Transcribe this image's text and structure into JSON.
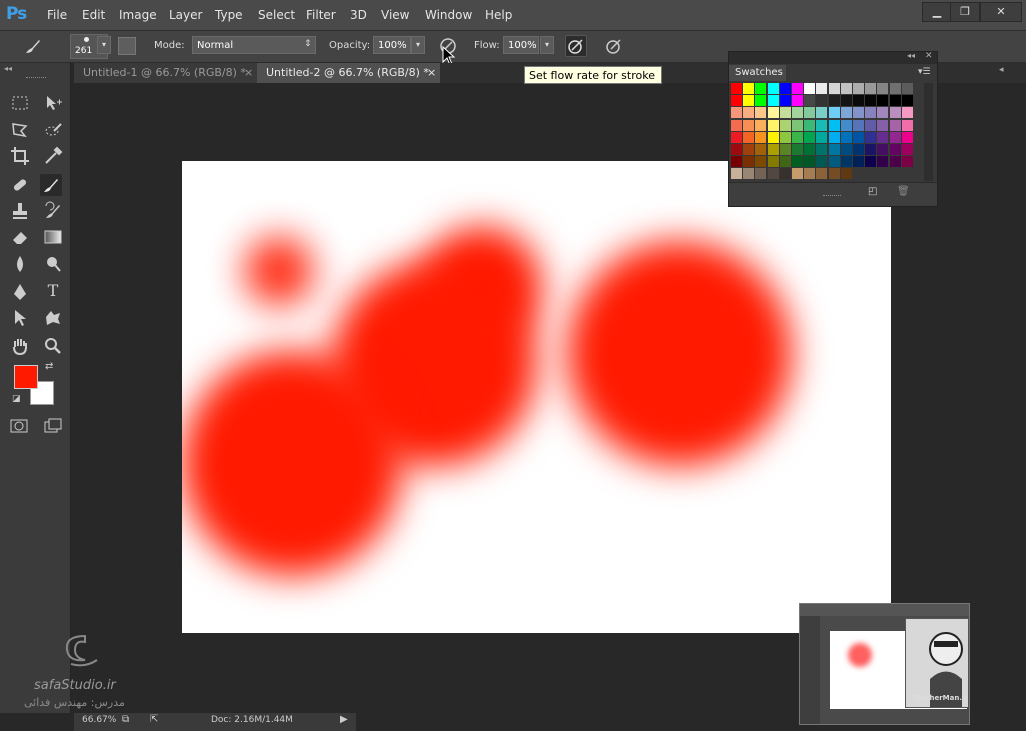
{
  "app": {
    "logo": "Ps"
  },
  "menu": [
    "File",
    "Edit",
    "Image",
    "Layer",
    "Type",
    "Select",
    "Filter",
    "3D",
    "View",
    "Window",
    "Help"
  ],
  "window_controls": {
    "minimize": "▁",
    "restore": "❐",
    "close": "✕"
  },
  "options": {
    "brush_size": "261",
    "mode_label": "Mode:",
    "mode_value": "Normal",
    "opacity_label": "Opacity:",
    "opacity_value": "100%",
    "flow_label": "Flow:",
    "flow_value": "100%"
  },
  "tooltip": "Set flow rate for stroke",
  "tabs": [
    {
      "label": "Untitled-1 @ 66.7% (RGB/8) *",
      "close": "×"
    },
    {
      "label": "Untitled-2 @ 66.7% (RGB/8) *",
      "close": "×"
    }
  ],
  "swatches_panel": {
    "title": "Swatches",
    "rows": [
      [
        "#ff0000",
        "#ffff00",
        "#00ff00",
        "#00ffff",
        "#0000ff",
        "#ff00ff",
        "#ffffff",
        "#ebebeb",
        "#d6d6d6",
        "#c2c2c2",
        "#adadad",
        "#999999",
        "#858585",
        "#707070",
        "#5c5c5c"
      ],
      [
        "#ff0000",
        "#ffff00",
        "#00ff00",
        "#00ffff",
        "#0000ff",
        "#ff00ff",
        "#474747",
        "#333333",
        "#1f1f1f",
        "#141414",
        "#0a0a0a",
        "#050505",
        "#000000",
        "#000000",
        "#000000"
      ],
      [
        "#f7977a",
        "#f9ad81",
        "#fdc68a",
        "#fff79a",
        "#c4df9b",
        "#a3d39c",
        "#82ca9d",
        "#7bcdc8",
        "#6ecff6",
        "#7ea7d8",
        "#8493ca",
        "#8882be",
        "#a187be",
        "#bc8dbf",
        "#f49ac2"
      ],
      [
        "#f26c4f",
        "#f68e55",
        "#fbaf5c",
        "#fff467",
        "#acd372",
        "#7cc576",
        "#3bb878",
        "#1abbb4",
        "#00bff3",
        "#438ccb",
        "#5574b9",
        "#605ca8",
        "#855fa8",
        "#a763a8",
        "#f06ea9"
      ],
      [
        "#ed1c24",
        "#f26522",
        "#f7941d",
        "#fff200",
        "#8dc73f",
        "#39b54a",
        "#00a651",
        "#00a99d",
        "#00aeef",
        "#0072bc",
        "#0054a6",
        "#2e3192",
        "#662d91",
        "#92278f",
        "#ec008c"
      ],
      [
        "#9e0b0f",
        "#a0410d",
        "#a36209",
        "#aba000",
        "#598527",
        "#1a7b30",
        "#007236",
        "#00746b",
        "#0076a3",
        "#004b80",
        "#003471",
        "#1b1464",
        "#440e62",
        "#630460",
        "#9e005d"
      ],
      [
        "#790000",
        "#7b2e00",
        "#7d4900",
        "#827b00",
        "#406618",
        "#005e20",
        "#005826",
        "#005952",
        "#005b7f",
        "#003663",
        "#002157",
        "#0d004c",
        "#32004b",
        "#4b0049",
        "#7b0046"
      ],
      [
        "#c7b299",
        "#998675",
        "#736357",
        "#534741",
        "#37302d",
        "#c69c6d",
        "#a67c52",
        "#8c6239",
        "#754c24",
        "#603913",
        "",
        "",
        "",
        "",
        ""
      ]
    ]
  },
  "colors": {
    "foreground": "#ff1a00",
    "background": "#ffffff",
    "brush": "#ff1a00"
  },
  "status": {
    "zoom": "66.67%",
    "doc": "Doc: 2.16M/1.44M"
  },
  "watermark": {
    "brand": "safaStudio.ir",
    "teacher": "مدرس: مهندس فدائی"
  },
  "thumbnail_watermark": "TeacherMan.ir"
}
